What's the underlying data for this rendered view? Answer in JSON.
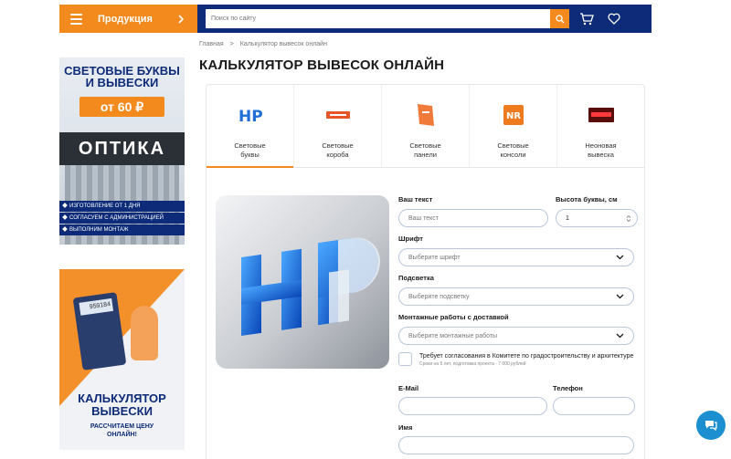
{
  "header": {
    "products_label": "Продукция",
    "search_placeholder": "Поиск по сайту"
  },
  "breadcrumb": {
    "home": "Главная",
    "separator": ">",
    "current": "Калькулятор вывесок онлайн"
  },
  "page_title": "КАЛЬКУЛЯТОР ВЫВЕСОК ОНЛАЙН",
  "banner_left_top": {
    "title_line1": "СВЕТОВЫЕ БУКВЫ",
    "title_line2": "И ВЫВЕСКИ",
    "price": "от 60 ₽",
    "sign_text": "ОПТИКА",
    "bullets": [
      "ИЗГОТОВЛЕНИЕ ОТ 1 ДНЯ",
      "СОГЛАСУЕМ С АДМИНИСТРАЦИЕЙ",
      "ВЫПОЛНИМ МОНТАЖ"
    ]
  },
  "banner_left_bottom": {
    "calc_screen": "959184",
    "title_line1": "КАЛЬКУЛЯТОР",
    "title_line2": "ВЫВЕСКИ",
    "sub_line1": "РАССЧИТАЕМ ЦЕНУ",
    "sub_line2": "ОНЛАЙН!"
  },
  "tabs": [
    {
      "line1": "Световые",
      "line2": "буквы",
      "icon": "light-letters-icon",
      "active": true
    },
    {
      "line1": "Световые",
      "line2": "короба",
      "icon": "light-box-icon",
      "active": false
    },
    {
      "line1": "Световые",
      "line2": "панели",
      "icon": "light-panel-icon",
      "active": false
    },
    {
      "line1": "Световые",
      "line2": "консоли",
      "icon": "light-console-icon",
      "active": false
    },
    {
      "line1": "Неоновая",
      "line2": "вывеска",
      "icon": "neon-sign-icon",
      "active": false
    }
  ],
  "preview": {
    "letters": "HP"
  },
  "form": {
    "text_label": "Ваш текст",
    "text_placeholder": "Ваш текст",
    "height_label": "Высота буквы, см",
    "height_value": "1",
    "font_label": "Шрифт",
    "font_placeholder": "Выберите шрифт",
    "light_label": "Подсветка",
    "light_placeholder": "Выберите подсветку",
    "install_label": "Монтажные работы с доставкой",
    "install_placeholder": "Выберите монтажные работы",
    "approval_text": "Требует согласования в Комитете по градостроительству и архитектуре",
    "approval_note": "Сроки на 5 лет, подготовка проекта - 7 000 рублей",
    "email_label": "E-Mail",
    "phone_label": "Телефон",
    "name_label": "Имя"
  },
  "colors": {
    "brand_orange": "#f28a1e",
    "brand_navy": "#0d2b78",
    "chat_blue": "#1b8fd0"
  }
}
